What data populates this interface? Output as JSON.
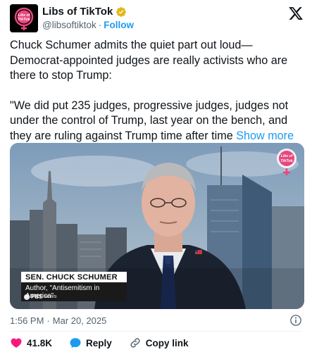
{
  "author": {
    "display_name": "Libs of TikTok",
    "handle": "@libsoftiktok",
    "separator": "·",
    "follow_label": "Follow",
    "avatar_text_line1": "Libs of",
    "avatar_text_line2": "TikTok",
    "verified_icon": "verified-badge-icon"
  },
  "tweet": {
    "paragraph1": "Chuck Schumer admits the quiet part out loud—Democrat-appointed judges are really activists who are there to stop Trump:",
    "paragraph2": "\"We did put 235 judges, progressive judges, judges not under the control of Trump, last year on the bench, and they are ruling against Trump time after time",
    "show_more_label": "Show more"
  },
  "media": {
    "lower_third_name": "SEN. CHUCK SCHUMER",
    "lower_third_title": "Author, \"Antisemitism in America\"",
    "network_bug": "PBS",
    "network_sub": "NEWS",
    "watermark_line1": "Libs of",
    "watermark_line2": "TikTok"
  },
  "meta": {
    "time": "1:56 PM",
    "separator": "·",
    "date": "Mar 20, 2025"
  },
  "actions": {
    "likes_count": "41.8K",
    "reply_label": "Reply",
    "copy_link_label": "Copy link"
  },
  "colors": {
    "link_blue": "#1d9bf0",
    "like_red": "#f91880",
    "muted_gray": "#536471"
  }
}
